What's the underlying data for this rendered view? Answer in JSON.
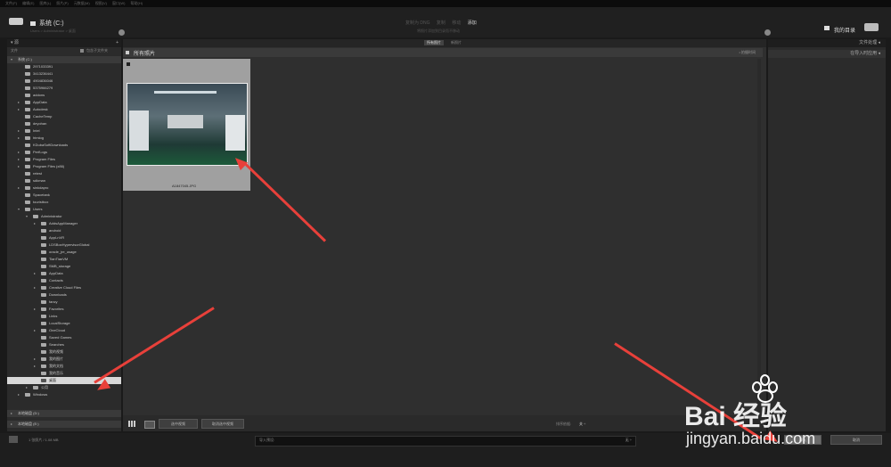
{
  "menu": [
    "文件(F)",
    "编辑(E)",
    "图库(L)",
    "照片(P)",
    "元数据(M)",
    "视图(V)",
    "窗口(W)",
    "帮助(H)"
  ],
  "header": {
    "source_label": "系统 (C:)",
    "source_path": "Users > Administrator > 桌面",
    "modes": [
      "复制为 DNG",
      "复制",
      "移动",
      "添加"
    ],
    "active_mode": "添加",
    "mode_desc": "将照片添加到目录而不移动",
    "dest_label": "我的目录"
  },
  "left_panel": {
    "title": "源",
    "include_sub": "包含子文件夹",
    "files_label": "文件",
    "drive": "系统 (C:)",
    "other_drives": [
      "本地磁盘 (D:)",
      "本地磁盘 (E:)"
    ],
    "tree": [
      {
        "label": "2971033391",
        "tri": "",
        "indent": 0
      },
      {
        "label": "3413236441",
        "tri": "",
        "indent": 0
      },
      {
        "label": "4904836046",
        "tri": "",
        "indent": 0
      },
      {
        "label": "5375966279",
        "tri": "",
        "indent": 0
      },
      {
        "label": "addons",
        "tri": "",
        "indent": 0
      },
      {
        "label": "AppData",
        "tri": "▸",
        "indent": 0
      },
      {
        "label": "Autodesk",
        "tri": "▸",
        "indent": 0
      },
      {
        "label": "CacheTemp",
        "tri": "",
        "indent": 0
      },
      {
        "label": "deyohan",
        "tri": "",
        "indent": 0
      },
      {
        "label": "Intel",
        "tri": "▸",
        "indent": 0
      },
      {
        "label": "htmlog",
        "tri": "▸",
        "indent": 0
      },
      {
        "label": "KDubaSoftDownloads",
        "tri": "",
        "indent": 0
      },
      {
        "label": "PerfLogs",
        "tri": "▸",
        "indent": 0
      },
      {
        "label": "Program Files",
        "tri": "▸",
        "indent": 0
      },
      {
        "label": "Program Files (x86)",
        "tri": "▸",
        "indent": 0
      },
      {
        "label": "retest",
        "tri": "",
        "indent": 0
      },
      {
        "label": "sdkman",
        "tri": "",
        "indent": 0
      },
      {
        "label": "sinkdapro",
        "tri": "▸",
        "indent": 0
      },
      {
        "label": "Spacetank",
        "tri": "",
        "indent": 0
      },
      {
        "label": "touristbox",
        "tri": "",
        "indent": 0
      },
      {
        "label": "Users",
        "tri": "▾",
        "indent": 0
      },
      {
        "label": "Administrator",
        "tri": "▾",
        "indent": 1
      },
      {
        "label": "AddsAppManager",
        "tri": "▸",
        "indent": 2
      },
      {
        "label": "android",
        "tri": "",
        "indent": 2
      },
      {
        "label": "AppLnVR",
        "tri": "",
        "indent": 2
      },
      {
        "label": "LDSBoxHypervisorGlobal",
        "tri": "",
        "indent": 2
      },
      {
        "label": "oracle_jre_usage",
        "tri": "",
        "indent": 2
      },
      {
        "label": "TianTianVM",
        "tri": "",
        "indent": 2
      },
      {
        "label": "SMB_storage",
        "tri": "",
        "indent": 2
      },
      {
        "label": "AppData",
        "tri": "▸",
        "indent": 2
      },
      {
        "label": "Contacts",
        "tri": "",
        "indent": 2
      },
      {
        "label": "Creative Cloud Files",
        "tri": "▸",
        "indent": 2
      },
      {
        "label": "Downloads",
        "tri": "",
        "indent": 2
      },
      {
        "label": "fancy",
        "tri": "",
        "indent": 2
      },
      {
        "label": "Favorites",
        "tri": "▸",
        "indent": 2
      },
      {
        "label": "Links",
        "tri": "",
        "indent": 2
      },
      {
        "label": "LocalStorage",
        "tri": "",
        "indent": 2
      },
      {
        "label": "OneCloud",
        "tri": "▸",
        "indent": 2
      },
      {
        "label": "Saved Games",
        "tri": "",
        "indent": 2
      },
      {
        "label": "Searches",
        "tri": "",
        "indent": 2
      },
      {
        "label": "我的视频",
        "tri": "",
        "indent": 2
      },
      {
        "label": "我的图片",
        "tri": "▸",
        "indent": 2
      },
      {
        "label": "我的文档",
        "tri": "▸",
        "indent": 2
      },
      {
        "label": "我的音乐",
        "tri": "",
        "indent": 2
      },
      {
        "label": "桌面",
        "tri": "",
        "indent": 2,
        "selected": true
      },
      {
        "label": "公用",
        "tri": "▸",
        "indent": 1
      },
      {
        "label": "Windows",
        "tri": "▸",
        "indent": 0
      }
    ]
  },
  "center": {
    "tabs": [
      "所有照片",
      "新照片"
    ],
    "grid_title": "所有照片",
    "sort_label": "• 拍摄时间",
    "photo_name": "A1847045.JPG",
    "check_all_button": "选中视频",
    "uncheck_all_button": "取消选中视频",
    "sort_bottom_label": "排序依据:",
    "sort_bottom_value": "关 ÷"
  },
  "right_panel": {
    "sections": [
      "文件处理",
      "在导入时应用"
    ]
  },
  "bottom": {
    "status": "1 张照片 / 1.08 MB",
    "preset_label": "导入预设:",
    "preset_value": "无 ÷",
    "import_button": "导入",
    "cancel_button": "取消"
  },
  "watermark": {
    "brand": "Bai 经验",
    "url": "jingyan.baidu.com"
  }
}
